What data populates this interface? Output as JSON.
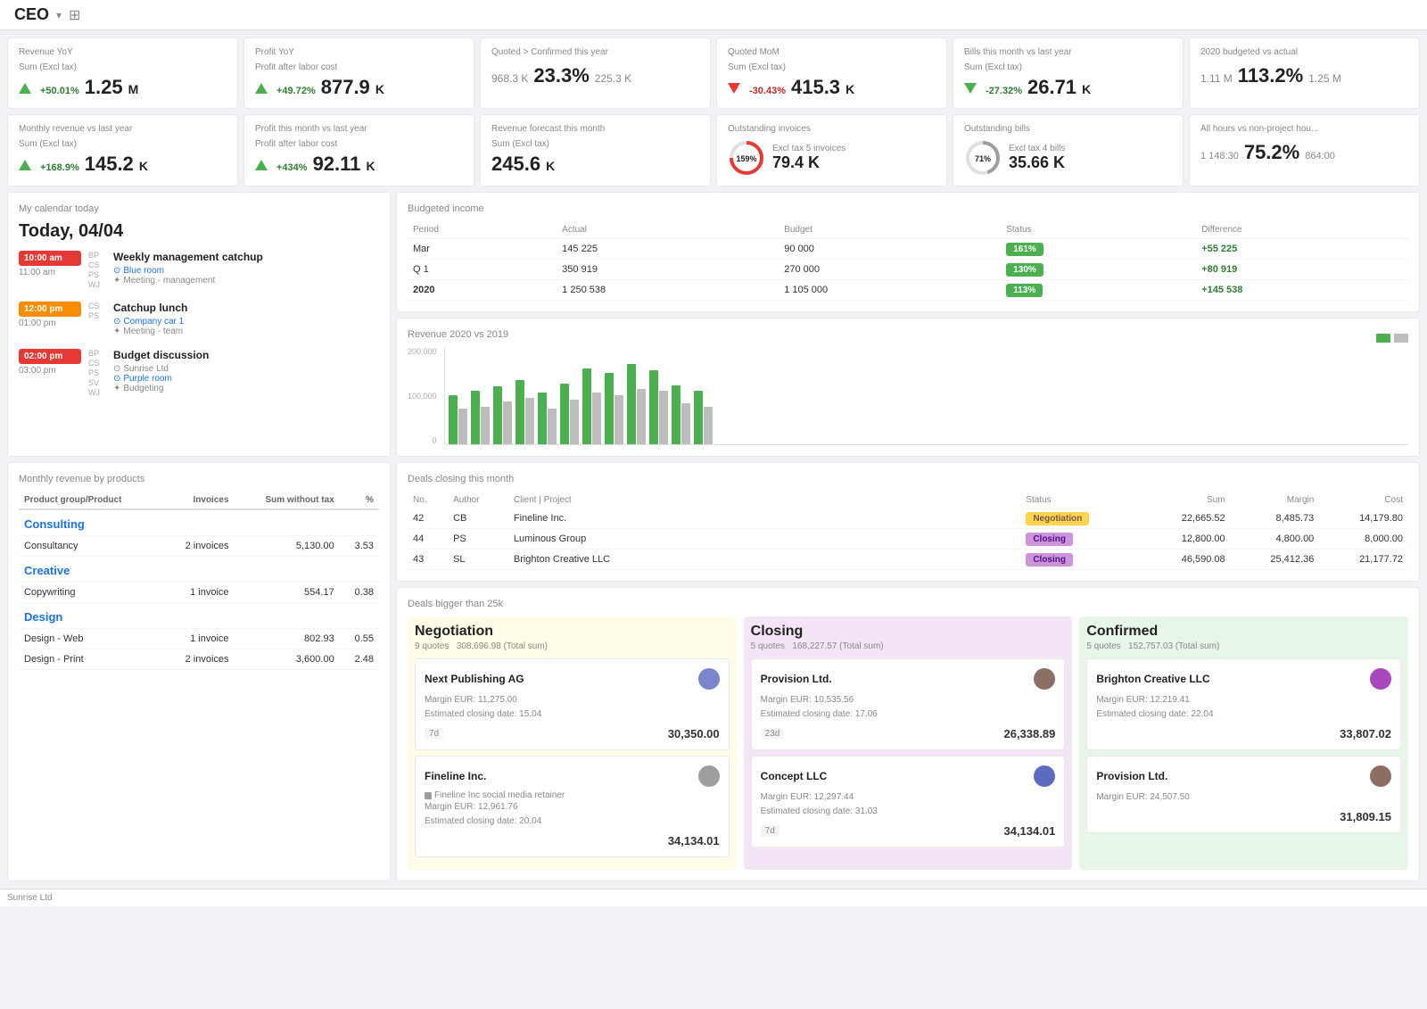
{
  "topbar": {
    "title": "CEO",
    "settings_icon": "⊞"
  },
  "kpi_row1": [
    {
      "label": "Revenue YoY",
      "sublabel": "Sum (Excl tax)",
      "change": "+50.01%",
      "change_dir": "up",
      "value": "1.25",
      "unit": "M"
    },
    {
      "label": "Profit YoY",
      "sublabel": "Profit after labor cost",
      "change": "+49.72%",
      "change_dir": "up",
      "value": "877.9",
      "unit": "K"
    },
    {
      "label": "Quoted > Confirmed this year",
      "left_val": "968.3 K",
      "pct": "23.3%",
      "right_val": "225.3 K"
    },
    {
      "label": "Quoted MoM",
      "sublabel": "Sum (Excl tax)",
      "change": "-30.43%",
      "change_dir": "down",
      "value": "415.3",
      "unit": "K"
    },
    {
      "label": "Bills this month vs last year",
      "sublabel": "Sum (Excl tax)",
      "change": "-27.32%",
      "change_dir": "down_green",
      "value": "26.71",
      "unit": "K"
    },
    {
      "label": "2020 budgeted vs actual",
      "left_val": "1.11 M",
      "pct": "113.2%",
      "right_val": "1.25 M"
    }
  ],
  "kpi_row2": [
    {
      "label": "Monthly revenue vs last year",
      "sublabel": "Sum (Excl tax)",
      "change": "+168.9%",
      "change_dir": "up",
      "value": "145.2",
      "unit": "K"
    },
    {
      "label": "Profit this month vs last year",
      "sublabel": "Profit after labor cost",
      "change": "+434%",
      "change_dir": "up",
      "value": "92.11",
      "unit": "K"
    },
    {
      "label": "Revenue forecast this month",
      "sublabel": "Sum (Excl tax)",
      "value": "245.6",
      "unit": "K"
    },
    {
      "label": "Outstanding invoices",
      "circle_pct": 159,
      "sublabel": "Excl tax 5 invoices",
      "value": "79.4",
      "unit": "K"
    },
    {
      "label": "Outstanding bills",
      "circle_pct": 71,
      "sublabel": "Excl tax 4 bills",
      "value": "35.66",
      "unit": "K"
    },
    {
      "label": "All hours vs non-project hou...",
      "left_val": "1 148:30",
      "pct": "75.2%",
      "right_val": "864:00"
    }
  ],
  "calendar": {
    "title": "My calendar today",
    "date": "Today, 04/04",
    "events": [
      {
        "time": "10:00 am",
        "end_time": "11:00 am",
        "color": "#e53935",
        "attendees": [
          "BP",
          "CS",
          "PS",
          "WJ"
        ],
        "title": "Weekly management catchup",
        "location": "Blue room",
        "tag": "Meeting - management"
      },
      {
        "time": "12:00 pm",
        "end_time": "01:00 pm",
        "color": "#fb8c00",
        "attendees": [
          "CS",
          "PS"
        ],
        "title": "Catchup lunch",
        "location": "Company car 1",
        "tag": "Meeting - team"
      },
      {
        "time": "02:00 pm",
        "end_time": "03:00 pm",
        "color": "#e53935",
        "attendees": [
          "BP",
          "CS",
          "PS",
          "SV",
          "WJ"
        ],
        "title": "Budget discussion",
        "location": "Sunrise Ltd",
        "room": "Purple room",
        "tag": "Budgeting"
      }
    ]
  },
  "budgeted": {
    "title": "Budgeted income",
    "columns": [
      "Period",
      "Actual",
      "Budget",
      "Status",
      "Difference"
    ],
    "rows": [
      {
        "period": "Mar",
        "actual": "145 225",
        "budget": "90 000",
        "status_pct": 161,
        "difference": "+55 225"
      },
      {
        "period": "Q 1",
        "actual": "350 919",
        "budget": "270 000",
        "status_pct": 130,
        "difference": "+80 919"
      },
      {
        "period": "2020",
        "actual": "1 250 538",
        "budget": "1 105 000",
        "status_pct": 113,
        "difference": "+145 538"
      }
    ]
  },
  "revenue_chart": {
    "title": "Revenue 2020 vs 2019",
    "y_labels": [
      "200,000",
      "100,000",
      "0"
    ],
    "bars": [
      {
        "green": 55,
        "gray": 40
      },
      {
        "green": 65,
        "gray": 45
      },
      {
        "green": 70,
        "gray": 50
      },
      {
        "green": 80,
        "gray": 55
      },
      {
        "green": 60,
        "gray": 42
      },
      {
        "green": 75,
        "gray": 52
      },
      {
        "green": 90,
        "gray": 60
      },
      {
        "green": 85,
        "gray": 58
      },
      {
        "green": 95,
        "gray": 65
      },
      {
        "green": 88,
        "gray": 62
      },
      {
        "green": 70,
        "gray": 48
      },
      {
        "green": 65,
        "gray": 45
      }
    ]
  },
  "deals_closing": {
    "title": "Deals closing this month",
    "columns": [
      "No.",
      "Author",
      "Client | Project",
      "Status",
      "Sum",
      "Margin",
      "Cost"
    ],
    "rows": [
      {
        "no": "42",
        "author": "CB",
        "client": "Fineline Inc.",
        "status": "Negotiation",
        "sum": "22,665.52",
        "margin": "8,485.73",
        "cost": "14,179.80"
      },
      {
        "no": "44",
        "author": "PS",
        "client": "Luminous Group",
        "status": "Closing",
        "sum": "12,800.00",
        "margin": "4,800.00",
        "cost": "8,000.00"
      },
      {
        "no": "43",
        "author": "SL",
        "client": "Brighton Creative LLC",
        "status": "Closing",
        "sum": "46,590.08",
        "margin": "25,412.36",
        "cost": "21,177.72"
      }
    ]
  },
  "products": {
    "title": "Monthly revenue by products",
    "columns": [
      "Product group/Product",
      "Invoices",
      "Sum without tax",
      "%"
    ],
    "groups": [
      {
        "name": "Consulting",
        "items": [
          {
            "name": "Consultancy",
            "invoices": "2 invoices",
            "sum": "5,130.00",
            "pct": "3.53"
          }
        ]
      },
      {
        "name": "Creative",
        "items": [
          {
            "name": "Copywriting",
            "invoices": "1 invoice",
            "sum": "554.17",
            "pct": "0.38"
          }
        ]
      },
      {
        "name": "Design",
        "items": [
          {
            "name": "Design - Web",
            "invoices": "1 invoice",
            "sum": "802.93",
            "pct": "0.55"
          },
          {
            "name": "Design - Print",
            "invoices": "2 invoices",
            "sum": "3,600.00",
            "pct": "2.48"
          }
        ]
      }
    ]
  },
  "deals_bigger": {
    "title": "Deals bigger than 25k",
    "columns": [
      {
        "name": "Negotiation",
        "count": "9 quotes",
        "total": "308,696.98 (Total sum)",
        "type": "negotiation",
        "cards": [
          {
            "client": "Next Publishing AG",
            "margin": "Margin EUR: 11,275.00",
            "closing": "Estimated closing date: 15.04",
            "days": "7d",
            "amount": "30,350.00",
            "has_avatar": true
          },
          {
            "client": "Fineline Inc.",
            "project": "Fineline Inc social media retainer",
            "margin": "Margin EUR: 12,961.76",
            "closing": "Estimated closing date: 20.04",
            "amount": "34,134.01",
            "has_avatar": true
          }
        ]
      },
      {
        "name": "Closing",
        "count": "5 quotes",
        "total": "168,227.57 (Total sum)",
        "type": "closing",
        "cards": [
          {
            "client": "Provision Ltd.",
            "margin": "Margin EUR: 10,535.56",
            "closing": "Estimated closing date: 17.06",
            "days": "23d",
            "amount": "26,338.89",
            "has_avatar": true
          },
          {
            "client": "Concept LLC",
            "margin": "Margin EUR: 12,297.44",
            "closing": "Estimated closing date: 31.03",
            "days": "7d",
            "amount": "34,134.01",
            "has_avatar": true
          }
        ]
      },
      {
        "name": "Confirmed",
        "count": "5 quotes",
        "total": "152,757.03 (Total sum)",
        "type": "confirmed",
        "cards": [
          {
            "client": "Brighton Creative LLC",
            "margin": "Margin EUR: 12,219.41",
            "closing": "Estimated closing date: 22.04",
            "amount": "33,807.02",
            "has_avatar": true
          },
          {
            "client": "Provision Ltd.",
            "margin": "Margin EUR: 24,507.50",
            "amount": "31,809.15",
            "has_avatar": true
          }
        ]
      }
    ]
  },
  "footer": {
    "company": "Sunrise Ltd"
  }
}
